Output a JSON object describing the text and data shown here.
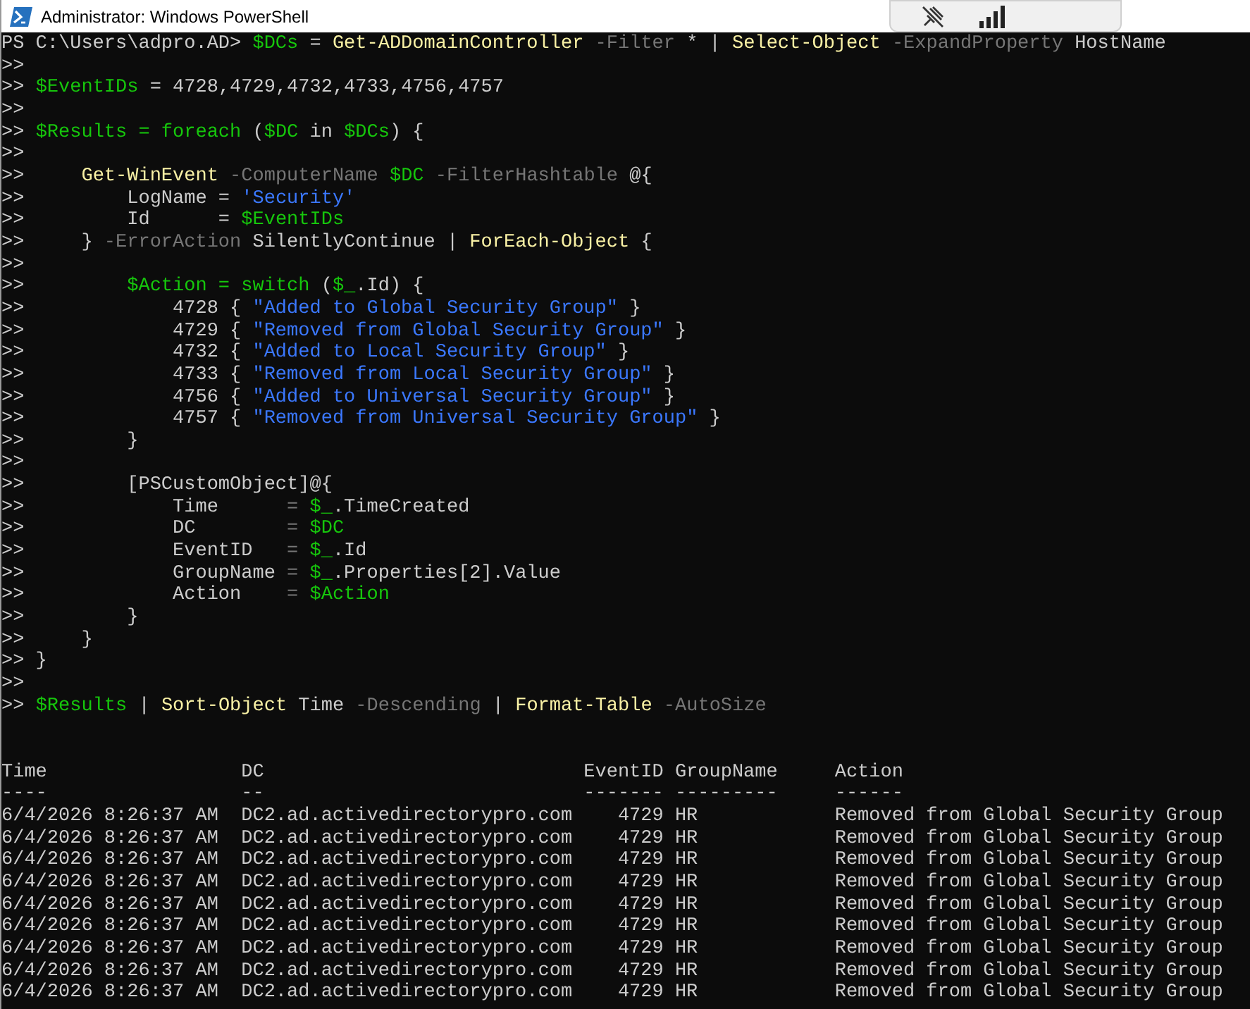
{
  "window": {
    "title": "Administrator: Windows PowerShell"
  },
  "console": {
    "lines": [
      [
        {
          "kind": "plain",
          "text": "PS C:\\Users\\adpro.AD> "
        },
        {
          "kind": "variable",
          "text": "$DCs"
        },
        {
          "kind": "plain",
          "text": " = "
        },
        {
          "kind": "command",
          "text": "Get-ADDomainController"
        },
        {
          "kind": "parameter",
          "text": " -Filter "
        },
        {
          "kind": "plain",
          "text": "* | "
        },
        {
          "kind": "command",
          "text": "Select-Object"
        },
        {
          "kind": "parameter",
          "text": " -ExpandProperty "
        },
        {
          "kind": "plain",
          "text": "HostName"
        }
      ],
      [
        {
          "kind": "plain",
          "text": ">>"
        }
      ],
      [
        {
          "kind": "plain",
          "text": ">> "
        },
        {
          "kind": "variable",
          "text": "$EventIDs"
        },
        {
          "kind": "plain",
          "text": " = 4728,4729,4732,4733,4756,4757"
        }
      ],
      [
        {
          "kind": "plain",
          "text": ">>"
        }
      ],
      [
        {
          "kind": "plain",
          "text": ">> "
        },
        {
          "kind": "variable",
          "text": "$Results = foreach"
        },
        {
          "kind": "plain",
          "text": " ("
        },
        {
          "kind": "variable",
          "text": "$DC"
        },
        {
          "kind": "plain",
          "text": " in "
        },
        {
          "kind": "variable",
          "text": "$DCs"
        },
        {
          "kind": "plain",
          "text": ") {"
        }
      ],
      [
        {
          "kind": "plain",
          "text": ">>"
        }
      ],
      [
        {
          "kind": "plain",
          "text": ">>     "
        },
        {
          "kind": "command",
          "text": "Get-WinEvent"
        },
        {
          "kind": "parameter",
          "text": " -ComputerName "
        },
        {
          "kind": "variable",
          "text": "$DC"
        },
        {
          "kind": "parameter",
          "text": " -FilterHashtable "
        },
        {
          "kind": "plain",
          "text": "@{"
        }
      ],
      [
        {
          "kind": "plain",
          "text": ">>         LogName = "
        },
        {
          "kind": "string",
          "text": "'Security'"
        }
      ],
      [
        {
          "kind": "plain",
          "text": ">>         Id      = "
        },
        {
          "kind": "variable",
          "text": "$EventIDs"
        }
      ],
      [
        {
          "kind": "plain",
          "text": ">>     }"
        },
        {
          "kind": "parameter",
          "text": " -ErrorAction "
        },
        {
          "kind": "plain",
          "text": "SilentlyContinue | "
        },
        {
          "kind": "command",
          "text": "ForEach-Object"
        },
        {
          "kind": "plain",
          "text": " {"
        }
      ],
      [
        {
          "kind": "plain",
          "text": ">>"
        }
      ],
      [
        {
          "kind": "plain",
          "text": ">>         "
        },
        {
          "kind": "variable",
          "text": "$Action = switch"
        },
        {
          "kind": "plain",
          "text": " ("
        },
        {
          "kind": "variable",
          "text": "$_"
        },
        {
          "kind": "plain",
          "text": ".Id) {"
        }
      ],
      [
        {
          "kind": "plain",
          "text": ">>             4728 { "
        },
        {
          "kind": "string",
          "text": "\"Added to Global Security Group\""
        },
        {
          "kind": "plain",
          "text": " }"
        }
      ],
      [
        {
          "kind": "plain",
          "text": ">>             4729 { "
        },
        {
          "kind": "string",
          "text": "\"Removed from Global Security Group\""
        },
        {
          "kind": "plain",
          "text": " }"
        }
      ],
      [
        {
          "kind": "plain",
          "text": ">>             4732 { "
        },
        {
          "kind": "string",
          "text": "\"Added to Local Security Group\""
        },
        {
          "kind": "plain",
          "text": " }"
        }
      ],
      [
        {
          "kind": "plain",
          "text": ">>             4733 { "
        },
        {
          "kind": "string",
          "text": "\"Removed from Local Security Group\""
        },
        {
          "kind": "plain",
          "text": " }"
        }
      ],
      [
        {
          "kind": "plain",
          "text": ">>             4756 { "
        },
        {
          "kind": "string",
          "text": "\"Added to Universal Security Group\""
        },
        {
          "kind": "plain",
          "text": " }"
        }
      ],
      [
        {
          "kind": "plain",
          "text": ">>             4757 { "
        },
        {
          "kind": "string",
          "text": "\"Removed from Universal Security Group\""
        },
        {
          "kind": "plain",
          "text": " }"
        }
      ],
      [
        {
          "kind": "plain",
          "text": ">>         }"
        }
      ],
      [
        {
          "kind": "plain",
          "text": ">>"
        }
      ],
      [
        {
          "kind": "plain",
          "text": ">>         [PSCustomObject]@{"
        }
      ],
      [
        {
          "kind": "plain",
          "text": ">>             Time      "
        },
        {
          "kind": "operator",
          "text": "= "
        },
        {
          "kind": "variable",
          "text": "$_"
        },
        {
          "kind": "plain",
          "text": ".TimeCreated"
        }
      ],
      [
        {
          "kind": "plain",
          "text": ">>             DC        "
        },
        {
          "kind": "operator",
          "text": "= "
        },
        {
          "kind": "variable",
          "text": "$DC"
        }
      ],
      [
        {
          "kind": "plain",
          "text": ">>             EventID   "
        },
        {
          "kind": "operator",
          "text": "= "
        },
        {
          "kind": "variable",
          "text": "$_"
        },
        {
          "kind": "plain",
          "text": ".Id"
        }
      ],
      [
        {
          "kind": "plain",
          "text": ">>             GroupName "
        },
        {
          "kind": "operator",
          "text": "= "
        },
        {
          "kind": "variable",
          "text": "$_"
        },
        {
          "kind": "plain",
          "text": ".Properties[2].Value"
        }
      ],
      [
        {
          "kind": "plain",
          "text": ">>             Action    "
        },
        {
          "kind": "operator",
          "text": "= "
        },
        {
          "kind": "variable",
          "text": "$Action"
        }
      ],
      [
        {
          "kind": "plain",
          "text": ">>         }"
        }
      ],
      [
        {
          "kind": "plain",
          "text": ">>     }"
        }
      ],
      [
        {
          "kind": "plain",
          "text": ">> }"
        }
      ],
      [
        {
          "kind": "plain",
          "text": ">>"
        }
      ],
      [
        {
          "kind": "plain",
          "text": ">> "
        },
        {
          "kind": "variable",
          "text": "$Results"
        },
        {
          "kind": "plain",
          "text": " | "
        },
        {
          "kind": "command",
          "text": "Sort-Object"
        },
        {
          "kind": "plain",
          "text": " Time"
        },
        {
          "kind": "parameter",
          "text": " -Descending "
        },
        {
          "kind": "plain",
          "text": "| "
        },
        {
          "kind": "command",
          "text": "Format-Table"
        },
        {
          "kind": "parameter",
          "text": " -AutoSize"
        }
      ]
    ]
  },
  "table": {
    "columns": [
      {
        "label": "Time",
        "rule": "----"
      },
      {
        "label": "DC",
        "rule": "--"
      },
      {
        "label": "EventID",
        "rule": "-------"
      },
      {
        "label": "GroupName",
        "rule": "---------"
      },
      {
        "label": "Action",
        "rule": "------"
      }
    ],
    "rows": [
      [
        "6/4/2026 8:26:37 AM",
        "DC2.ad.activedirectorypro.com",
        "4729",
        "HR",
        "Removed from Global Security Group"
      ],
      [
        "6/4/2026 8:26:37 AM",
        "DC2.ad.activedirectorypro.com",
        "4729",
        "HR",
        "Removed from Global Security Group"
      ],
      [
        "6/4/2026 8:26:37 AM",
        "DC2.ad.activedirectorypro.com",
        "4729",
        "HR",
        "Removed from Global Security Group"
      ],
      [
        "6/4/2026 8:26:37 AM",
        "DC2.ad.activedirectorypro.com",
        "4729",
        "HR",
        "Removed from Global Security Group"
      ],
      [
        "6/4/2026 8:26:37 AM",
        "DC2.ad.activedirectorypro.com",
        "4729",
        "HR",
        "Removed from Global Security Group"
      ],
      [
        "6/4/2026 8:26:37 AM",
        "DC2.ad.activedirectorypro.com",
        "4729",
        "HR",
        "Removed from Global Security Group"
      ],
      [
        "6/4/2026 8:26:37 AM",
        "DC2.ad.activedirectorypro.com",
        "4729",
        "HR",
        "Removed from Global Security Group"
      ],
      [
        "6/4/2026 8:26:37 AM",
        "DC2.ad.activedirectorypro.com",
        "4729",
        "HR",
        "Removed from Global Security Group"
      ],
      [
        "6/4/2026 8:26:37 AM",
        "DC2.ad.activedirectorypro.com",
        "4729",
        "HR",
        "Removed from Global Security Group"
      ]
    ]
  }
}
